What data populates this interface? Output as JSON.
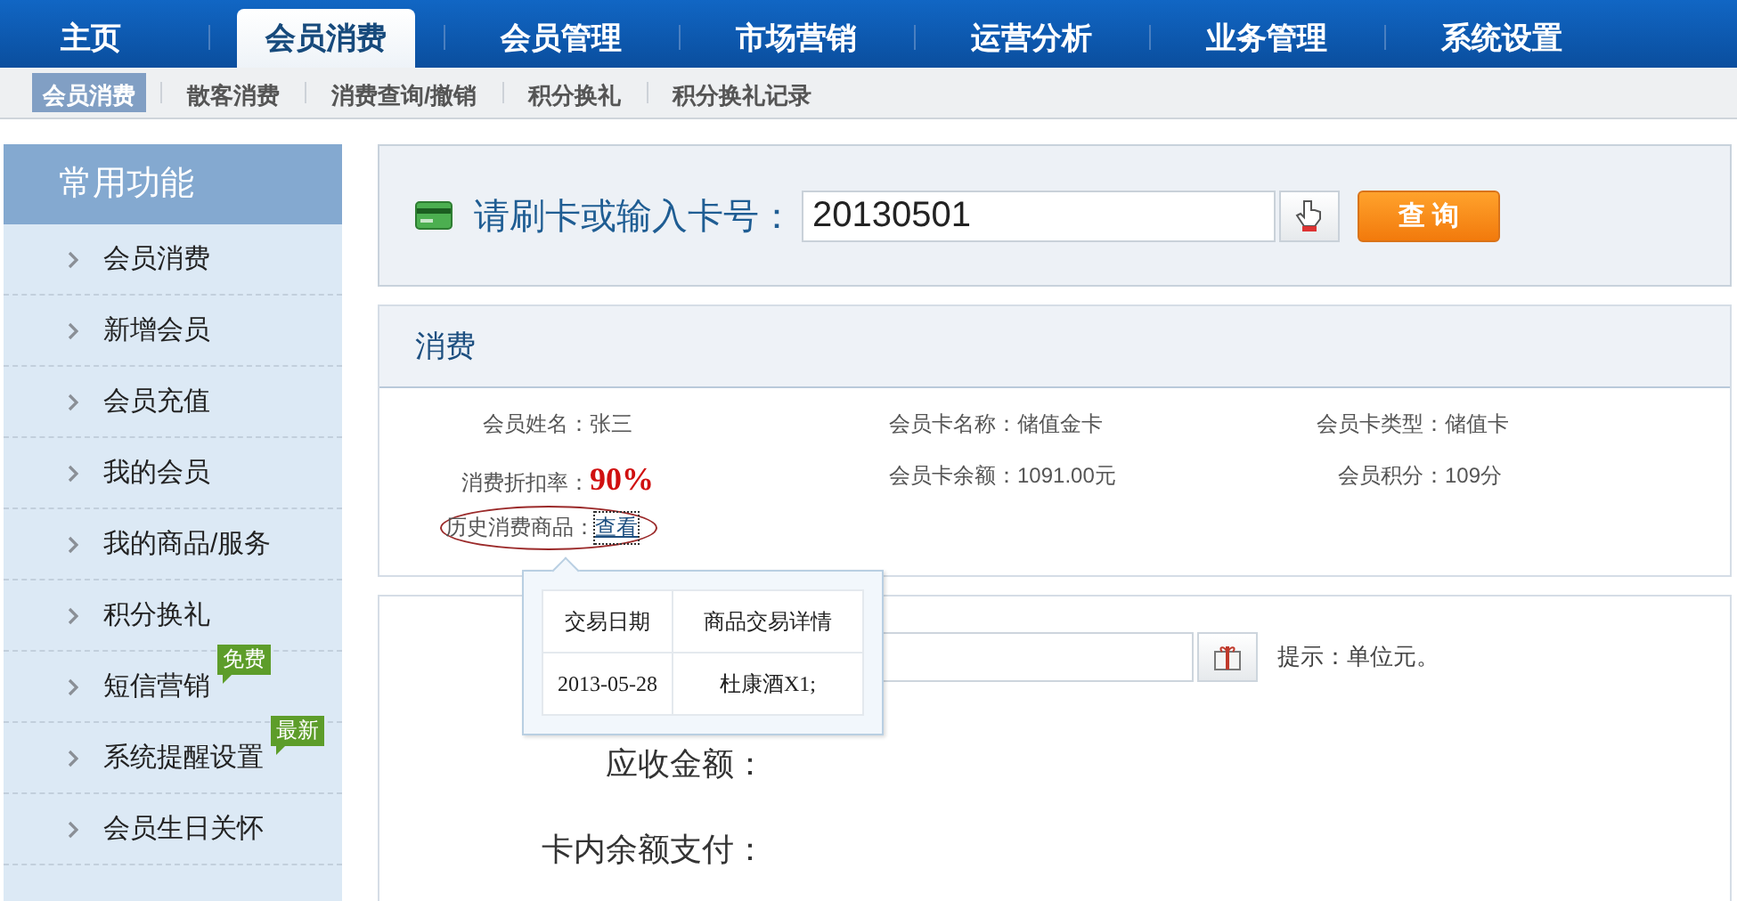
{
  "top_nav": [
    {
      "label": "主页",
      "selected": false
    },
    {
      "label": "会员消费",
      "selected": true
    },
    {
      "label": "会员管理",
      "selected": false
    },
    {
      "label": "市场营销",
      "selected": false
    },
    {
      "label": "运营分析",
      "selected": false
    },
    {
      "label": "业务管理",
      "selected": false
    },
    {
      "label": "系统设置",
      "selected": false
    }
  ],
  "sub_nav": [
    {
      "label": "会员消费",
      "selected": true
    },
    {
      "label": "散客消费",
      "selected": false
    },
    {
      "label": "消费查询/撤销",
      "selected": false
    },
    {
      "label": "积分换礼",
      "selected": false
    },
    {
      "label": "积分换礼记录",
      "selected": false
    }
  ],
  "sidebar": {
    "title": "常用功能",
    "items": [
      {
        "label": "会员消费"
      },
      {
        "label": "新增会员"
      },
      {
        "label": "会员充值"
      },
      {
        "label": "我的会员"
      },
      {
        "label": "我的商品/服务"
      },
      {
        "label": "积分换礼"
      },
      {
        "label": "短信营销",
        "badge": "免费"
      },
      {
        "label": "系统提醒设置",
        "badge": "最新"
      },
      {
        "label": "会员生日关怀"
      }
    ]
  },
  "card_search": {
    "label": "请刷卡或输入卡号：",
    "value": "20130501",
    "button": "查 询"
  },
  "consume": {
    "title": "消费",
    "fields": [
      {
        "label": "会员姓名：",
        "value": "张三",
        "kind": "plain"
      },
      {
        "label": "会员卡名称：",
        "value": "储值金卡",
        "kind": "plain"
      },
      {
        "label": "会员卡类型：",
        "value": "储值卡",
        "kind": "plain"
      },
      {
        "label": "消费折扣率：",
        "value": "90%",
        "kind": "emphasis"
      },
      {
        "label": "会员卡余额：",
        "value": "1091.00元",
        "kind": "plain"
      },
      {
        "label": "会员积分：",
        "value": "109分",
        "kind": "plain"
      }
    ],
    "history": {
      "label": "历史消费商品：",
      "link": "查看"
    }
  },
  "history_popup": {
    "columns": [
      "交易日期",
      "商品交易详情"
    ],
    "rows": [
      [
        "2013-05-28",
        "杜康酒X1;"
      ]
    ]
  },
  "payment": {
    "hint": "提示：单位元。",
    "rows": [
      {
        "label": "应收金额："
      },
      {
        "label": "卡内余额支付："
      }
    ]
  }
}
